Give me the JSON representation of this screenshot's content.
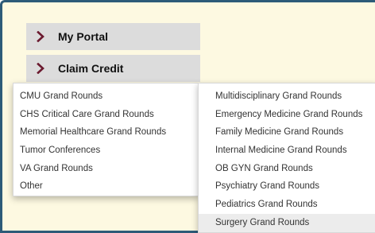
{
  "nav": {
    "my_portal": "My Portal",
    "claim_credit": "Claim Credit"
  },
  "claim_menu": {
    "items": [
      "CMU Grand Rounds",
      "CHS Critical Care Grand Rounds",
      "Memorial Healthcare Grand Rounds",
      "Tumor Conferences",
      "VA Grand Rounds",
      "Other"
    ]
  },
  "cmu_submenu": {
    "items": [
      "Multidisciplinary Grand Rounds",
      "Emergency Medicine Grand Rounds",
      "Family Medicine Grand Rounds",
      "Internal Medicine Grand Rounds",
      "OB GYN Grand Rounds",
      "Psychiatry Grand Rounds",
      "Pediatrics Grand Rounds",
      "Surgery Grand Rounds"
    ],
    "hovered": "Surgery Grand Rounds"
  },
  "colors": {
    "frame_border": "#2d5b78",
    "background": "#fdf9e1",
    "nav_button": "#dcdcdc",
    "chevron": "#6b1a2f"
  },
  "icons": {
    "chevron": "chevron-right-icon"
  }
}
